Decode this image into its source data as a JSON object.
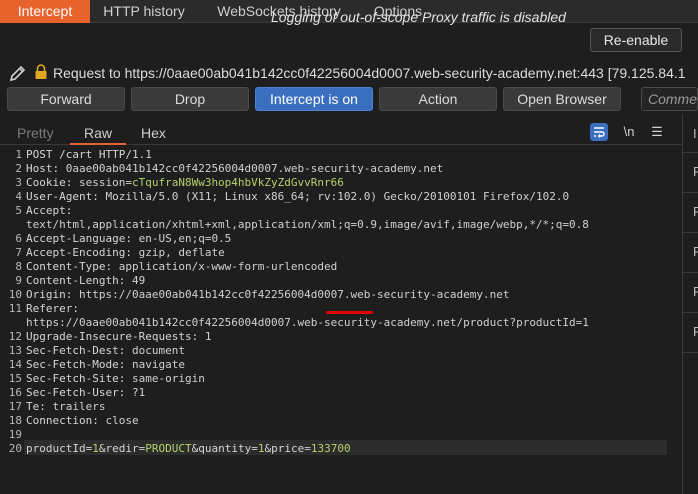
{
  "tabs": [
    "Intercept",
    "HTTP history",
    "WebSockets history",
    "Options"
  ],
  "log_message": "Logging of out-of-scope Proxy traffic is disabled",
  "reenable_label": "Re-enable",
  "request_line": "Request to https://0aae00ab041b142cc0f42256004d0007.web-security-academy.net:443  [79.125.84.1",
  "toolbar": {
    "forward": "Forward",
    "drop": "Drop",
    "intercept": "Intercept is on",
    "action": "Action",
    "open_browser": "Open Browser",
    "comment": "Commen"
  },
  "subtabs": [
    "Pretty",
    "Raw",
    "Hex"
  ],
  "tool_icons": [
    "wrap-icon",
    "newline-icon",
    "menu-icon"
  ],
  "newline_glyph": "\\n",
  "menu_glyph": "☰",
  "right_panel_letters": [
    "I",
    "R",
    "R",
    "R",
    "R",
    "R"
  ],
  "lines": [
    {
      "n": "1",
      "segs": [
        {
          "t": "POST /cart HTTP/1.1",
          "c": "k"
        }
      ]
    },
    {
      "n": "2",
      "segs": [
        {
          "t": "Host: ",
          "c": "k"
        },
        {
          "t": "0aae00ab041b142cc0f42256004d0007.web-security-academy.net",
          "c": "v"
        }
      ]
    },
    {
      "n": "3",
      "segs": [
        {
          "t": "Cookie: ",
          "c": "k"
        },
        {
          "t": "session=",
          "c": "v"
        },
        {
          "t": "cTqufraN8Ww3hop4hbVkZyZdGvvRnr66",
          "c": "g"
        }
      ]
    },
    {
      "n": "4",
      "segs": [
        {
          "t": "User-Agent: ",
          "c": "k"
        },
        {
          "t": "Mozilla/5.0 (X11; Linux x86_64; rv:102.0) Gecko/20100101 Firefox/102.0",
          "c": "v"
        }
      ]
    },
    {
      "n": "5",
      "segs": [
        {
          "t": "Accept:",
          "c": "k"
        }
      ]
    },
    {
      "n": "",
      "segs": [
        {
          "t": "text/html,application/xhtml+xml,application/xml;q=0.9,image/avif,image/webp,*/*;q=0.8",
          "c": "v"
        }
      ]
    },
    {
      "n": "6",
      "segs": [
        {
          "t": "Accept-Language: ",
          "c": "k"
        },
        {
          "t": "en-US,en;q=0.5",
          "c": "v"
        }
      ]
    },
    {
      "n": "7",
      "segs": [
        {
          "t": "Accept-Encoding: ",
          "c": "k"
        },
        {
          "t": "gzip, deflate",
          "c": "v"
        }
      ]
    },
    {
      "n": "8",
      "segs": [
        {
          "t": "Content-Type: ",
          "c": "k"
        },
        {
          "t": "application/x-www-form-urlencoded",
          "c": "v"
        }
      ]
    },
    {
      "n": "9",
      "segs": [
        {
          "t": "Content-Length: ",
          "c": "k"
        },
        {
          "t": "49",
          "c": "v"
        }
      ]
    },
    {
      "n": "10",
      "segs": [
        {
          "t": "Origin: ",
          "c": "k"
        },
        {
          "t": "https://0aae00ab041b142cc0f42256004d0007.web-security-academy.net",
          "c": "v"
        }
      ]
    },
    {
      "n": "11",
      "segs": [
        {
          "t": "Referer:",
          "c": "k"
        }
      ]
    },
    {
      "n": "",
      "segs": [
        {
          "t": "https://0aae00ab041b142cc0f42256004d0007.web-security-academy.net/product?productId=1",
          "c": "v"
        }
      ]
    },
    {
      "n": "12",
      "segs": [
        {
          "t": "Upgrade-Insecure-Requests: ",
          "c": "k"
        },
        {
          "t": "1",
          "c": "v"
        }
      ]
    },
    {
      "n": "13",
      "segs": [
        {
          "t": "Sec-Fetch-Dest: ",
          "c": "k"
        },
        {
          "t": "document",
          "c": "v"
        }
      ]
    },
    {
      "n": "14",
      "segs": [
        {
          "t": "Sec-Fetch-Mode: ",
          "c": "k"
        },
        {
          "t": "navigate",
          "c": "v"
        }
      ]
    },
    {
      "n": "15",
      "segs": [
        {
          "t": "Sec-Fetch-Site: ",
          "c": "k"
        },
        {
          "t": "same-origin",
          "c": "v"
        }
      ]
    },
    {
      "n": "16",
      "segs": [
        {
          "t": "Sec-Fetch-User: ",
          "c": "k"
        },
        {
          "t": "?1",
          "c": "v"
        }
      ]
    },
    {
      "n": "17",
      "segs": [
        {
          "t": "Te: ",
          "c": "k"
        },
        {
          "t": "trailers",
          "c": "v"
        }
      ]
    },
    {
      "n": "18",
      "segs": [
        {
          "t": "Connection: ",
          "c": "k"
        },
        {
          "t": "close",
          "c": "v"
        }
      ]
    },
    {
      "n": "19",
      "segs": []
    },
    {
      "n": "20",
      "segs": [
        {
          "t": "productId",
          "c": "k"
        },
        {
          "t": "=",
          "c": "v"
        },
        {
          "t": "1",
          "c": "g"
        },
        {
          "t": "&redir",
          "c": "k"
        },
        {
          "t": "=",
          "c": "v"
        },
        {
          "t": "PRODUCT",
          "c": "g"
        },
        {
          "t": "&quantity",
          "c": "k"
        },
        {
          "t": "=",
          "c": "v"
        },
        {
          "t": "1",
          "c": "g"
        },
        {
          "t": "&price",
          "c": "k"
        },
        {
          "t": "=",
          "c": "v"
        },
        {
          "t": "133700",
          "c": "g"
        }
      ]
    }
  ],
  "colors": {
    "accent": "#e8622c",
    "intercept_blue": "#3a6fc0",
    "value_green": "#b5d26a",
    "annotation_red": "#e00000"
  }
}
